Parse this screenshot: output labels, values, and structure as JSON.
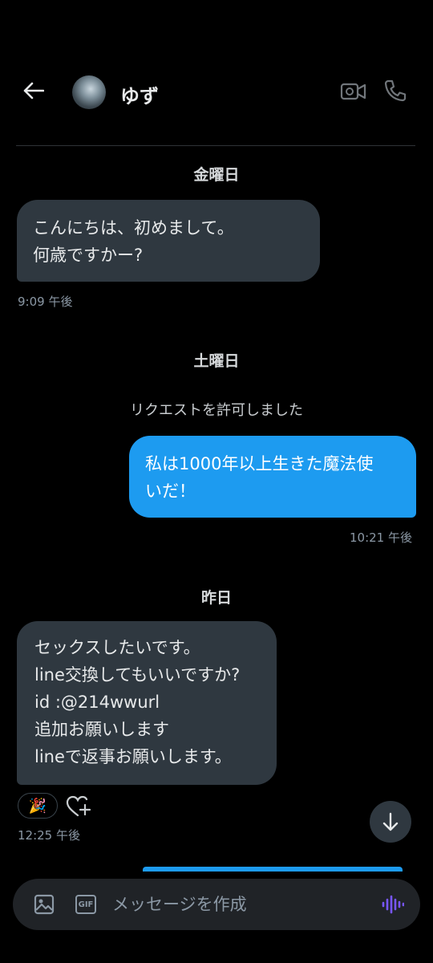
{
  "header": {
    "contact_name": "ゆず",
    "icons": [
      "back-arrow-icon",
      "avatar",
      "video-camera-icon",
      "phone-icon"
    ]
  },
  "conversation": {
    "days": [
      {
        "label": "金曜日"
      },
      {
        "label": "土曜日"
      },
      {
        "label": "昨日"
      }
    ],
    "system_message": "リクエストを許可しました",
    "messages": [
      {
        "direction": "incoming",
        "lines": [
          "こんにちは、初めまして。",
          "何歳ですかー?"
        ],
        "time": "9:09 午後"
      },
      {
        "direction": "outgoing",
        "lines": [
          "私は1000年以上生きた魔法使",
          "いだ！"
        ],
        "time": "10:21 午後"
      },
      {
        "direction": "incoming",
        "lines": [
          "セックスしたいです。",
          "line交換してもいいですか?",
          "id :@214wwurl",
          "追加お願いします",
          "lineで返事お願いします。"
        ],
        "time": "12:25 午後",
        "reaction": "🎉"
      }
    ]
  },
  "composer": {
    "placeholder": "メッセージを作成",
    "gif_label": "GIF"
  },
  "colors": {
    "background": "#000000",
    "incoming_bubble": "#2f3840",
    "outgoing_bubble": "#1d9bf0",
    "accent_voice": "#7856ff"
  }
}
